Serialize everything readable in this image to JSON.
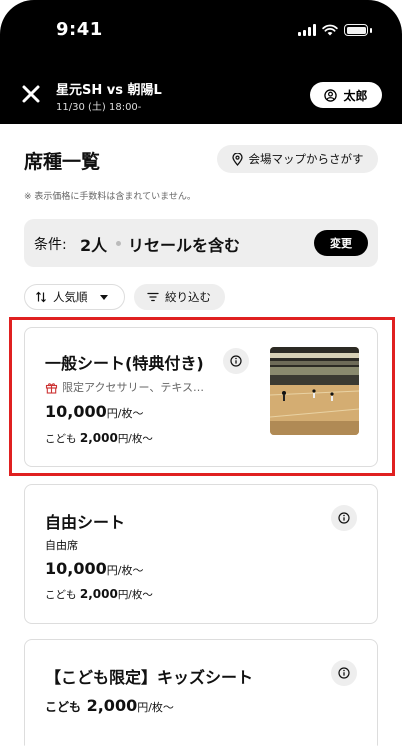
{
  "status": {
    "time": "9:41"
  },
  "header": {
    "match_title": "星元SH vs 朝陽L",
    "match_date": "11/30 (土) 18:00-",
    "user_label": "太郎"
  },
  "page": {
    "title": "席種一覧",
    "map_button": "会場マップからさがす",
    "fee_note": "※ 表示価格に手数料は含まれていません。"
  },
  "condition": {
    "label": "条件:",
    "people": "2人",
    "resale": "リセールを含む",
    "change_button": "変更"
  },
  "filters": {
    "sort_label": "人気順",
    "filter_label": "絞り込む"
  },
  "cards": [
    {
      "title": "一般シート(特典付き)",
      "perk": "限定アクセサリー、テキス…",
      "price": "10,000",
      "price_unit": "円/枚〜",
      "kids_label": "こども",
      "kids_price": "2,000",
      "kids_unit": "円/枚〜"
    },
    {
      "title": "自由シート",
      "sub": "自由席",
      "price": "10,000",
      "price_unit": "円/枚〜",
      "kids_label": "こども",
      "kids_price": "2,000",
      "kids_unit": "円/枚〜"
    },
    {
      "title": "【こども限定】キッズシート",
      "kids_label": "こども",
      "price": "2,000",
      "price_unit": "円/枚〜"
    }
  ],
  "colors": {
    "header_bg": "#000000",
    "highlight": "#e02020",
    "chip_bg": "#eeeeee"
  },
  "icons": [
    "close-icon",
    "user-icon",
    "map-pin-icon",
    "sort-icon",
    "filter-icon",
    "info-icon",
    "gift-icon"
  ]
}
